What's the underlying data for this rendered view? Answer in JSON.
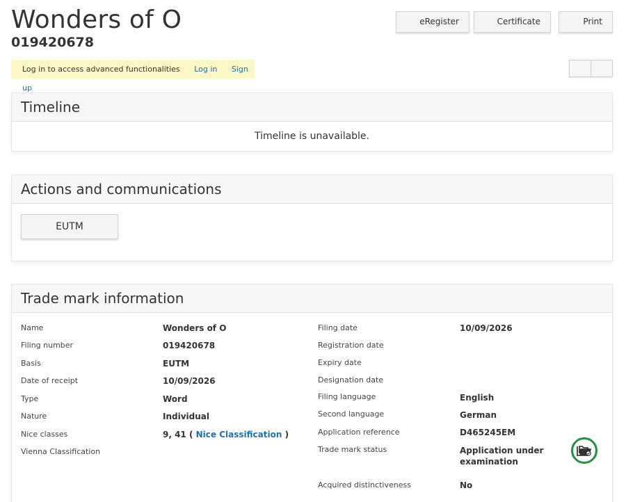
{
  "header": {
    "title": "Wonders of O",
    "number": "019420678"
  },
  "toolbar": {
    "eregister_label": "eRegister",
    "certificate_label": "Certificate",
    "print_label": "Print"
  },
  "login_bar": {
    "message": "Log in to access advanced functionalities",
    "login_label": "Log in",
    "signup_label": "Sign up"
  },
  "timeline": {
    "heading": "Timeline",
    "message": "Timeline is unavailable."
  },
  "actions": {
    "heading": "Actions and communications",
    "eutm_label": "EUTM"
  },
  "trade_mark_info": {
    "heading": "Trade mark information",
    "left": [
      {
        "label": "Name",
        "value": "Wonders of O"
      },
      {
        "label": "Filing number",
        "value": "019420678"
      },
      {
        "label": "Basis",
        "value": "EUTM"
      },
      {
        "label": "Date of receipt",
        "value": "10/09/2026"
      },
      {
        "label": "Type",
        "value": "Word"
      },
      {
        "label": "Nature",
        "value": "Individual"
      },
      {
        "label": "Nice classes",
        "value": "9, 41 (",
        "link": "Nice Classification",
        "suffix": ")"
      },
      {
        "label": "Vienna Classification",
        "value": ""
      }
    ],
    "right": [
      {
        "label": "Filing date",
        "value": "10/09/2026"
      },
      {
        "label": "Registration date",
        "value": ""
      },
      {
        "label": "Expiry date",
        "value": ""
      },
      {
        "label": "Designation date",
        "value": ""
      },
      {
        "label": "Filing language",
        "value": "English"
      },
      {
        "label": "Second language",
        "value": "German"
      },
      {
        "label": "Application reference",
        "value": "D465245EM"
      },
      {
        "label": "Trade mark status",
        "value": "Application under examination"
      },
      {
        "label": "Acquired distinctiveness",
        "value": "No"
      }
    ],
    "status_icon": "folder-status-icon",
    "status_color": "#1e8f3c"
  }
}
